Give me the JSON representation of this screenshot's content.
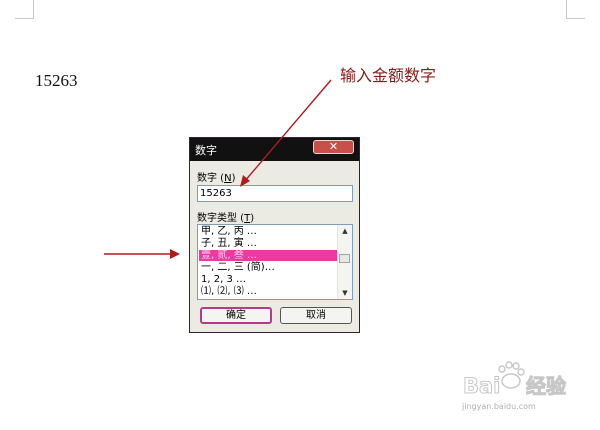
{
  "document": {
    "text": "15263"
  },
  "annotation": {
    "label": "输入金额数字",
    "color": "#8b1a1a"
  },
  "dialog": {
    "title": "数字",
    "close_symbol": "✕",
    "number_label": "数字",
    "number_key": "N",
    "number_value": "15263",
    "type_label": "数字类型",
    "type_key": "T",
    "list_items": [
      "甲, 乙, 丙 …",
      "子, 丑, 寅 …",
      "壹, 贰, 叁 …",
      "一, 二, 三 (简)…",
      "1, 2, 3 …",
      "⑴, ⑵, ⑶ …"
    ],
    "selected_index": 2,
    "ok_label": "确定",
    "cancel_label": "取消",
    "selection_color": "#ee3aa0"
  },
  "watermark": {
    "brand": "Bai 经验",
    "url": "jingyan.baidu.com"
  }
}
